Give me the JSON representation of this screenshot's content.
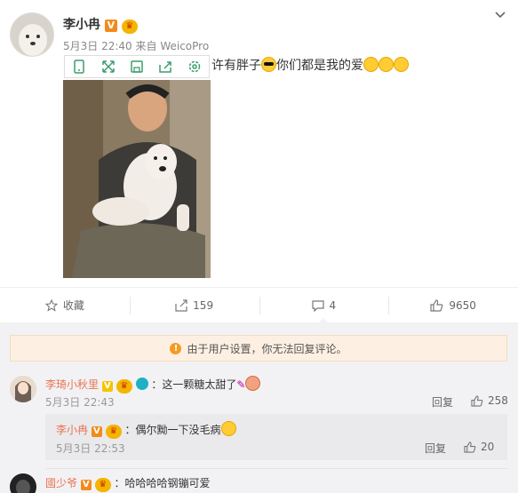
{
  "post": {
    "username": "李小冉",
    "verified_badge": "V",
    "member_badge": "vip",
    "date": "5月3日 22:40",
    "source": "来自 WeicoPro",
    "text_visible": "许有胖子",
    "text_after": "你们都是我的爱"
  },
  "media_toolbar": [
    "phone-icon",
    "expand-icon",
    "save-icon",
    "share-icon",
    "settings-icon"
  ],
  "actions": {
    "favorite": "收藏",
    "forward": "159",
    "comment": "4",
    "like": "9650"
  },
  "notice": {
    "text": "由于用户设置，你无法回复评论。"
  },
  "comments": [
    {
      "user": "李琦小秋里",
      "text": "：这一颗糖太甜了",
      "time": "5月3日 22:43",
      "reply_label": "回复",
      "likes": "258"
    },
    {
      "user": "國少爷",
      "text": "：哈哈哈哈钢镚可爱"
    }
  ],
  "reply": {
    "user": "李小冉",
    "text": "：偶尔黝一下没毛病",
    "time": "5月3日 22:53",
    "reply_label": "回复",
    "likes": "20"
  },
  "colors": {
    "link": "#eb7350",
    "badge_orange": "#f18c1c",
    "notice_bg": "#fdf0e3"
  }
}
